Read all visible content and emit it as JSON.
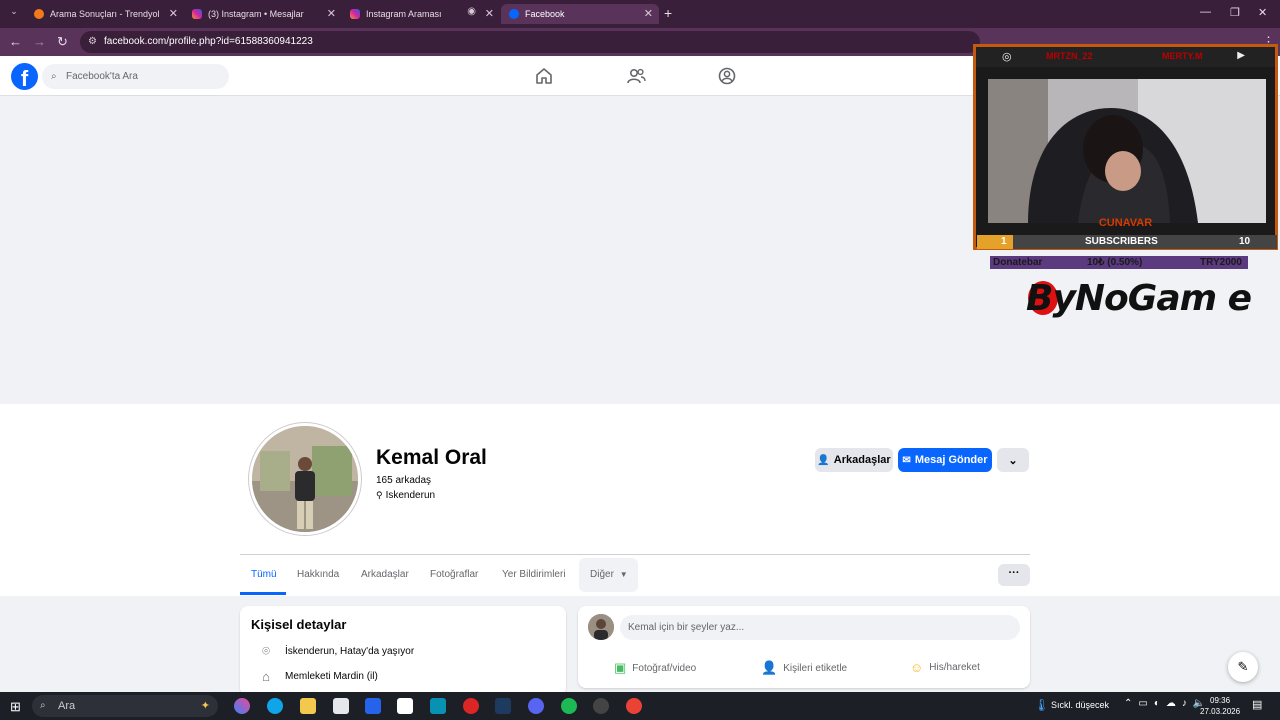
{
  "browser": {
    "tabs": [
      {
        "title": "Arama Sonuçları - Trendyol",
        "favicon_color": "#f27a1a"
      },
      {
        "title": "(3) Instagram • Mesajlar",
        "favicon_color": "#d6249f"
      },
      {
        "title": "Instagram Araması",
        "favicon_color": "#d6249f"
      },
      {
        "title": "Facebook",
        "favicon_color": "#0866ff"
      }
    ],
    "url": "facebook.com/profile.php?id=61588360941223"
  },
  "fb": {
    "logo": "f",
    "search_placeholder": "Facebook'ta Ara"
  },
  "profile": {
    "name": "Kemal Oral",
    "friends_count": "165 arkadaş",
    "location": "Iskenderun",
    "btn_friends": "Arkadaşlar",
    "btn_message": "Mesaj Gönder",
    "tabs": [
      "Tümü",
      "Hakkında",
      "Arkadaşlar",
      "Fotoğraflar",
      "Yer Bildirimleri",
      "Diğer"
    ]
  },
  "details": {
    "title": "Kişisel detaylar",
    "rows": [
      "İskenderun, Hatay'da yaşıyor",
      "Memleketi Mardin (il)"
    ]
  },
  "post": {
    "placeholder": "Kemal için bir şeyler yaz...",
    "actions": [
      "Fotoğraf/video",
      "Kişileri etiketle",
      "His/hareket"
    ]
  },
  "overlay": {
    "name_left": "MRTZN_22",
    "name_right": "MERTY.M",
    "label": "CUNAVAR",
    "sub_left": "1",
    "sub_title": "SUBSCRIBERS",
    "sub_right": "10",
    "donate_label": "Donatebar",
    "donate_value": "10₺ (0.50%)",
    "donate_goal": "TRY2000",
    "logo": "ByNoGam e"
  },
  "taskbar": {
    "search_placeholder": "Ara",
    "weather": "Sıckl. düşecek",
    "time": "09:36",
    "date": "27.03.2026"
  },
  "colors": {
    "accent": "#0866ff",
    "tab_bg": "#3a1f3a",
    "overlay_orange": "#c45a10"
  }
}
